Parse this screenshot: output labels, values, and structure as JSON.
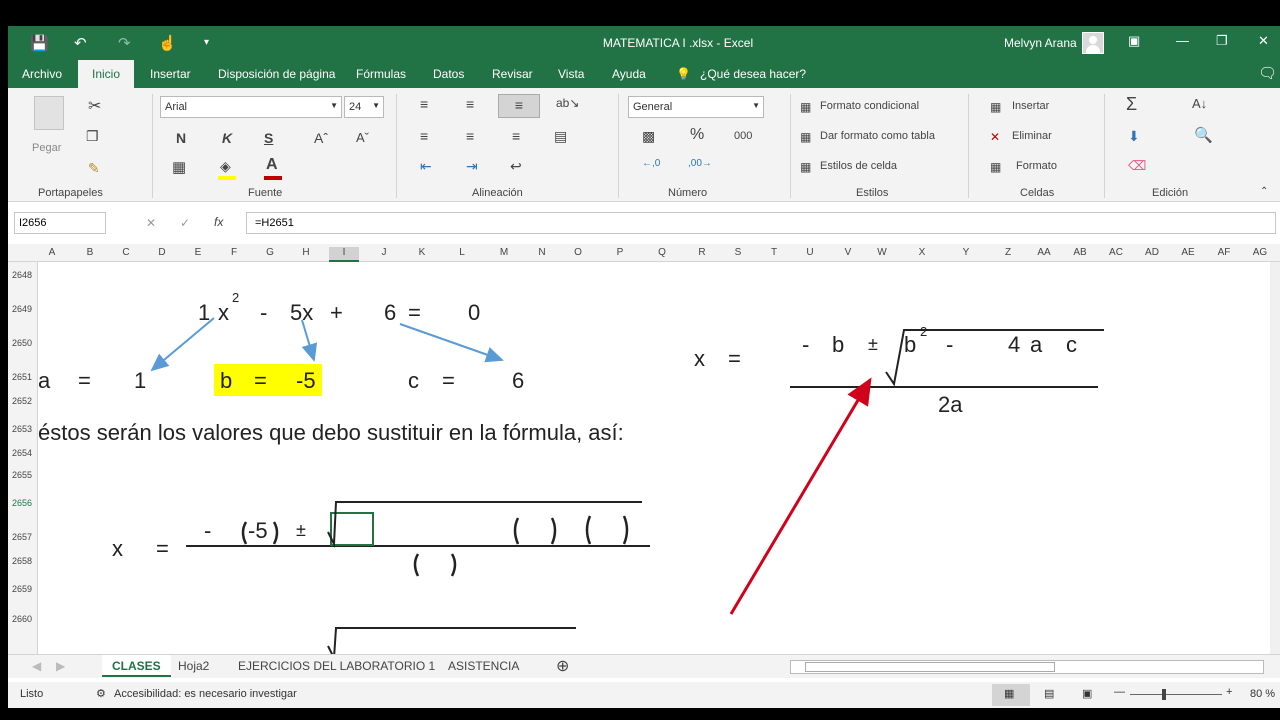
{
  "titlebar": {
    "title": "MATEMATICA I .xlsx  -  Excel",
    "user": "Melvyn Arana"
  },
  "tabs": [
    "Archivo",
    "Inicio",
    "Insertar",
    "Disposición de página",
    "Fórmulas",
    "Datos",
    "Revisar",
    "Vista",
    "Ayuda",
    "¿Qué desea hacer?"
  ],
  "ribbon": {
    "paste_label": "Pegar",
    "font_name": "Arial",
    "font_size": "24",
    "bold": "N",
    "italic": "K",
    "underline": "S",
    "number_format": "General",
    "percent": "%",
    "thousands": "000",
    "cond_format": "Formato condicional",
    "format_table": "Dar formato como tabla",
    "cell_styles": "Estilos de celda",
    "insert": "Insertar",
    "delete": "Eliminar",
    "format": "Formato",
    "groups": [
      "Portapapeles",
      "Fuente",
      "Alineación",
      "Número",
      "Estilos",
      "Celdas",
      "Edición"
    ]
  },
  "formulabar": {
    "name_box": "I2656",
    "formula": "=H2651",
    "fx": "fx"
  },
  "columns": [
    "A",
    "B",
    "C",
    "D",
    "E",
    "F",
    "G",
    "H",
    "I",
    "J",
    "K",
    "L",
    "M",
    "N",
    "O",
    "P",
    "Q",
    "R",
    "S",
    "T",
    "U",
    "V",
    "W",
    "X",
    "Y",
    "Z",
    "AA",
    "AB",
    "AC",
    "AD",
    "AE",
    "AF",
    "AG"
  ],
  "rows": [
    "2648",
    "2649",
    "2650",
    "2651",
    "2652",
    "2653",
    "2654",
    "2655",
    "2656",
    "2657",
    "2658",
    "2659",
    "2660"
  ],
  "sheet": {
    "eq_1": "1",
    "eq_x": "x",
    "eq_2": "2",
    "eq_minus": "-",
    "eq_5x": "5x",
    "eq_plus": "+",
    "eq_6": "6",
    "eq_equals": "=",
    "eq_0": "0",
    "a_label": "a",
    "a_eq": "=",
    "a_val": "1",
    "b_label": "b",
    "b_eq": "=",
    "b_val": "-5",
    "c_label": "c",
    "c_eq": "=",
    "c_val": "6",
    "sentence": "éstos serán los valores que debo sustituir en la fórmula, así:",
    "f_x": "x",
    "f_eq": "=",
    "f_minus": "-",
    "f_b": "b",
    "f_pm": "±",
    "f_b2": "b",
    "f_sup2": "2",
    "f_minus2": "-",
    "f_4": "4",
    "f_a": "a",
    "f_c": "c",
    "f_2a": "2a",
    "s_x": "x",
    "s_eq": "=",
    "s_minus": "-",
    "s_paren_b": "-5",
    "s_pm": "±"
  },
  "sheets": [
    "CLASES",
    "Hoja2",
    "EJERCICIOS DEL LABORATORIO 1",
    "ASISTENCIA"
  ],
  "status": {
    "ready": "Listo",
    "accessibility": "Accesibilidad: es necesario investigar",
    "zoom": "80 %"
  },
  "colors": {
    "excel_green": "#217346",
    "highlight": "#ffff00",
    "red_arrow": "#d0021b",
    "blue_arrow": "#5b9bd5"
  }
}
